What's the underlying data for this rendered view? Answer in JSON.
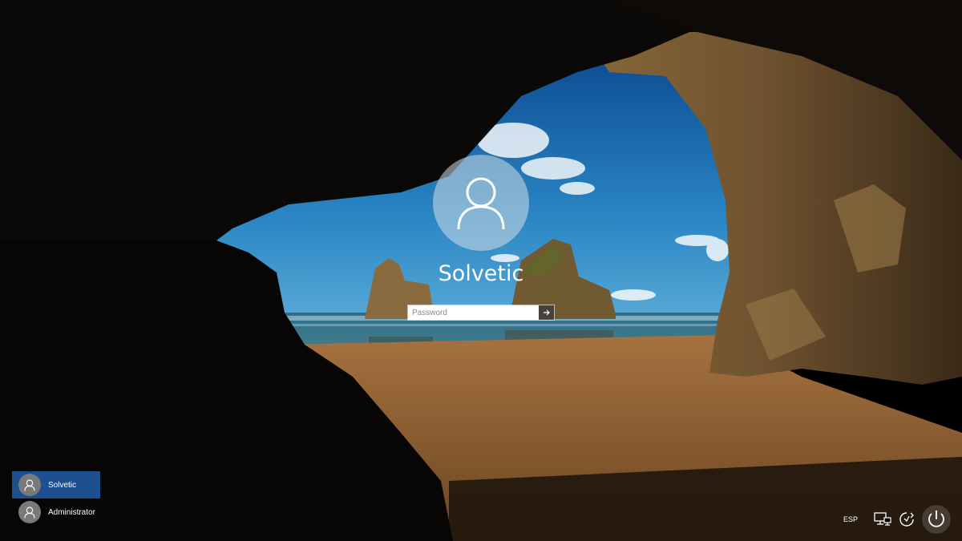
{
  "login": {
    "username": "Solvetic",
    "password_placeholder": "Password"
  },
  "user_list": [
    {
      "name": "Solvetic",
      "selected": true
    },
    {
      "name": "Administrator",
      "selected": false
    }
  ],
  "system_tray": {
    "language": "ESP",
    "icons": [
      "network-icon",
      "ease-of-access-icon",
      "power-icon"
    ]
  },
  "colors": {
    "selected_user_bg": "#1e4f8f",
    "avatar_circle": "#d2dce4",
    "sky": "#1f74b4"
  }
}
